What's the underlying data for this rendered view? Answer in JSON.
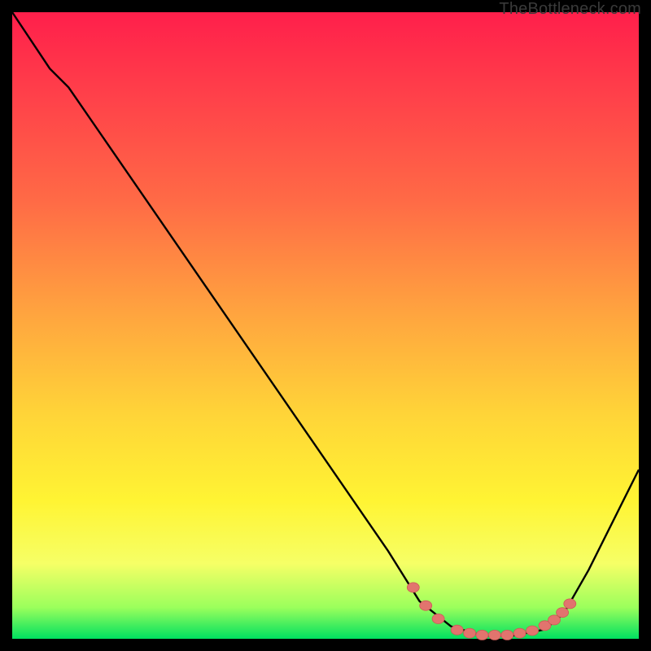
{
  "watermark": "TheBottleneck.com",
  "colors": {
    "curve": "#000000",
    "marker_fill": "#e2746e",
    "marker_stroke": "#cc5b55"
  },
  "chart_data": {
    "type": "line",
    "title": "",
    "xlabel": "",
    "ylabel": "",
    "xlim": [
      0,
      100
    ],
    "ylim": [
      0,
      100
    ],
    "curve": [
      {
        "x": 0,
        "y": 100
      },
      {
        "x": 6,
        "y": 91
      },
      {
        "x": 9,
        "y": 88
      },
      {
        "x": 60,
        "y": 14
      },
      {
        "x": 65,
        "y": 6
      },
      {
        "x": 70,
        "y": 2
      },
      {
        "x": 75,
        "y": 0.5
      },
      {
        "x": 80,
        "y": 0.5
      },
      {
        "x": 85,
        "y": 1.5
      },
      {
        "x": 88,
        "y": 4
      },
      {
        "x": 92,
        "y": 11
      },
      {
        "x": 100,
        "y": 27
      }
    ],
    "markers": [
      {
        "x": 64,
        "y": 8.2
      },
      {
        "x": 66,
        "y": 5.3
      },
      {
        "x": 68,
        "y": 3.2
      },
      {
        "x": 71,
        "y": 1.4
      },
      {
        "x": 73,
        "y": 0.9
      },
      {
        "x": 75,
        "y": 0.6
      },
      {
        "x": 77,
        "y": 0.6
      },
      {
        "x": 79,
        "y": 0.6
      },
      {
        "x": 81,
        "y": 0.9
      },
      {
        "x": 83,
        "y": 1.3
      },
      {
        "x": 85,
        "y": 2.1
      },
      {
        "x": 86.5,
        "y": 3.0
      },
      {
        "x": 87.8,
        "y": 4.2
      },
      {
        "x": 89.0,
        "y": 5.6
      }
    ]
  }
}
